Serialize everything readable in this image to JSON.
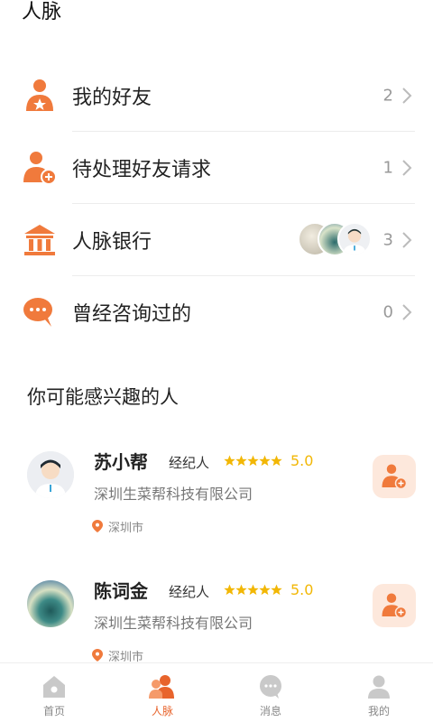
{
  "header": {
    "title": "人脉"
  },
  "menu": [
    {
      "label": "我的好友",
      "count": "2",
      "icon": "friend-star-icon"
    },
    {
      "label": "待处理好友请求",
      "count": "1",
      "icon": "add-friend-icon"
    },
    {
      "label": "人脉银行",
      "count": "3",
      "icon": "bank-icon"
    },
    {
      "label": "曾经咨询过的",
      "count": "0",
      "icon": "chat-bubble-icon"
    }
  ],
  "recommend": {
    "title": "你可能感兴趣的人",
    "people": [
      {
        "name": "苏小帮",
        "role": "经纪人",
        "rating": "5.0",
        "company": "深圳生菜帮科技有限公司",
        "city": "深圳市",
        "stars": 5
      },
      {
        "name": "陈词金",
        "role": "经纪人",
        "rating": "5.0",
        "company": "深圳生菜帮科技有限公司",
        "city": "深圳市",
        "stars": 5
      }
    ]
  },
  "tabs": [
    {
      "label": "首页",
      "icon": "home-icon",
      "active": false
    },
    {
      "label": "人脉",
      "icon": "contacts-icon",
      "active": true
    },
    {
      "label": "消息",
      "icon": "message-icon",
      "active": false
    },
    {
      "label": "我的",
      "icon": "profile-icon",
      "active": false
    }
  ],
  "colors": {
    "accent": "#e8642c",
    "star": "#f2b705",
    "muted": "#999999"
  }
}
